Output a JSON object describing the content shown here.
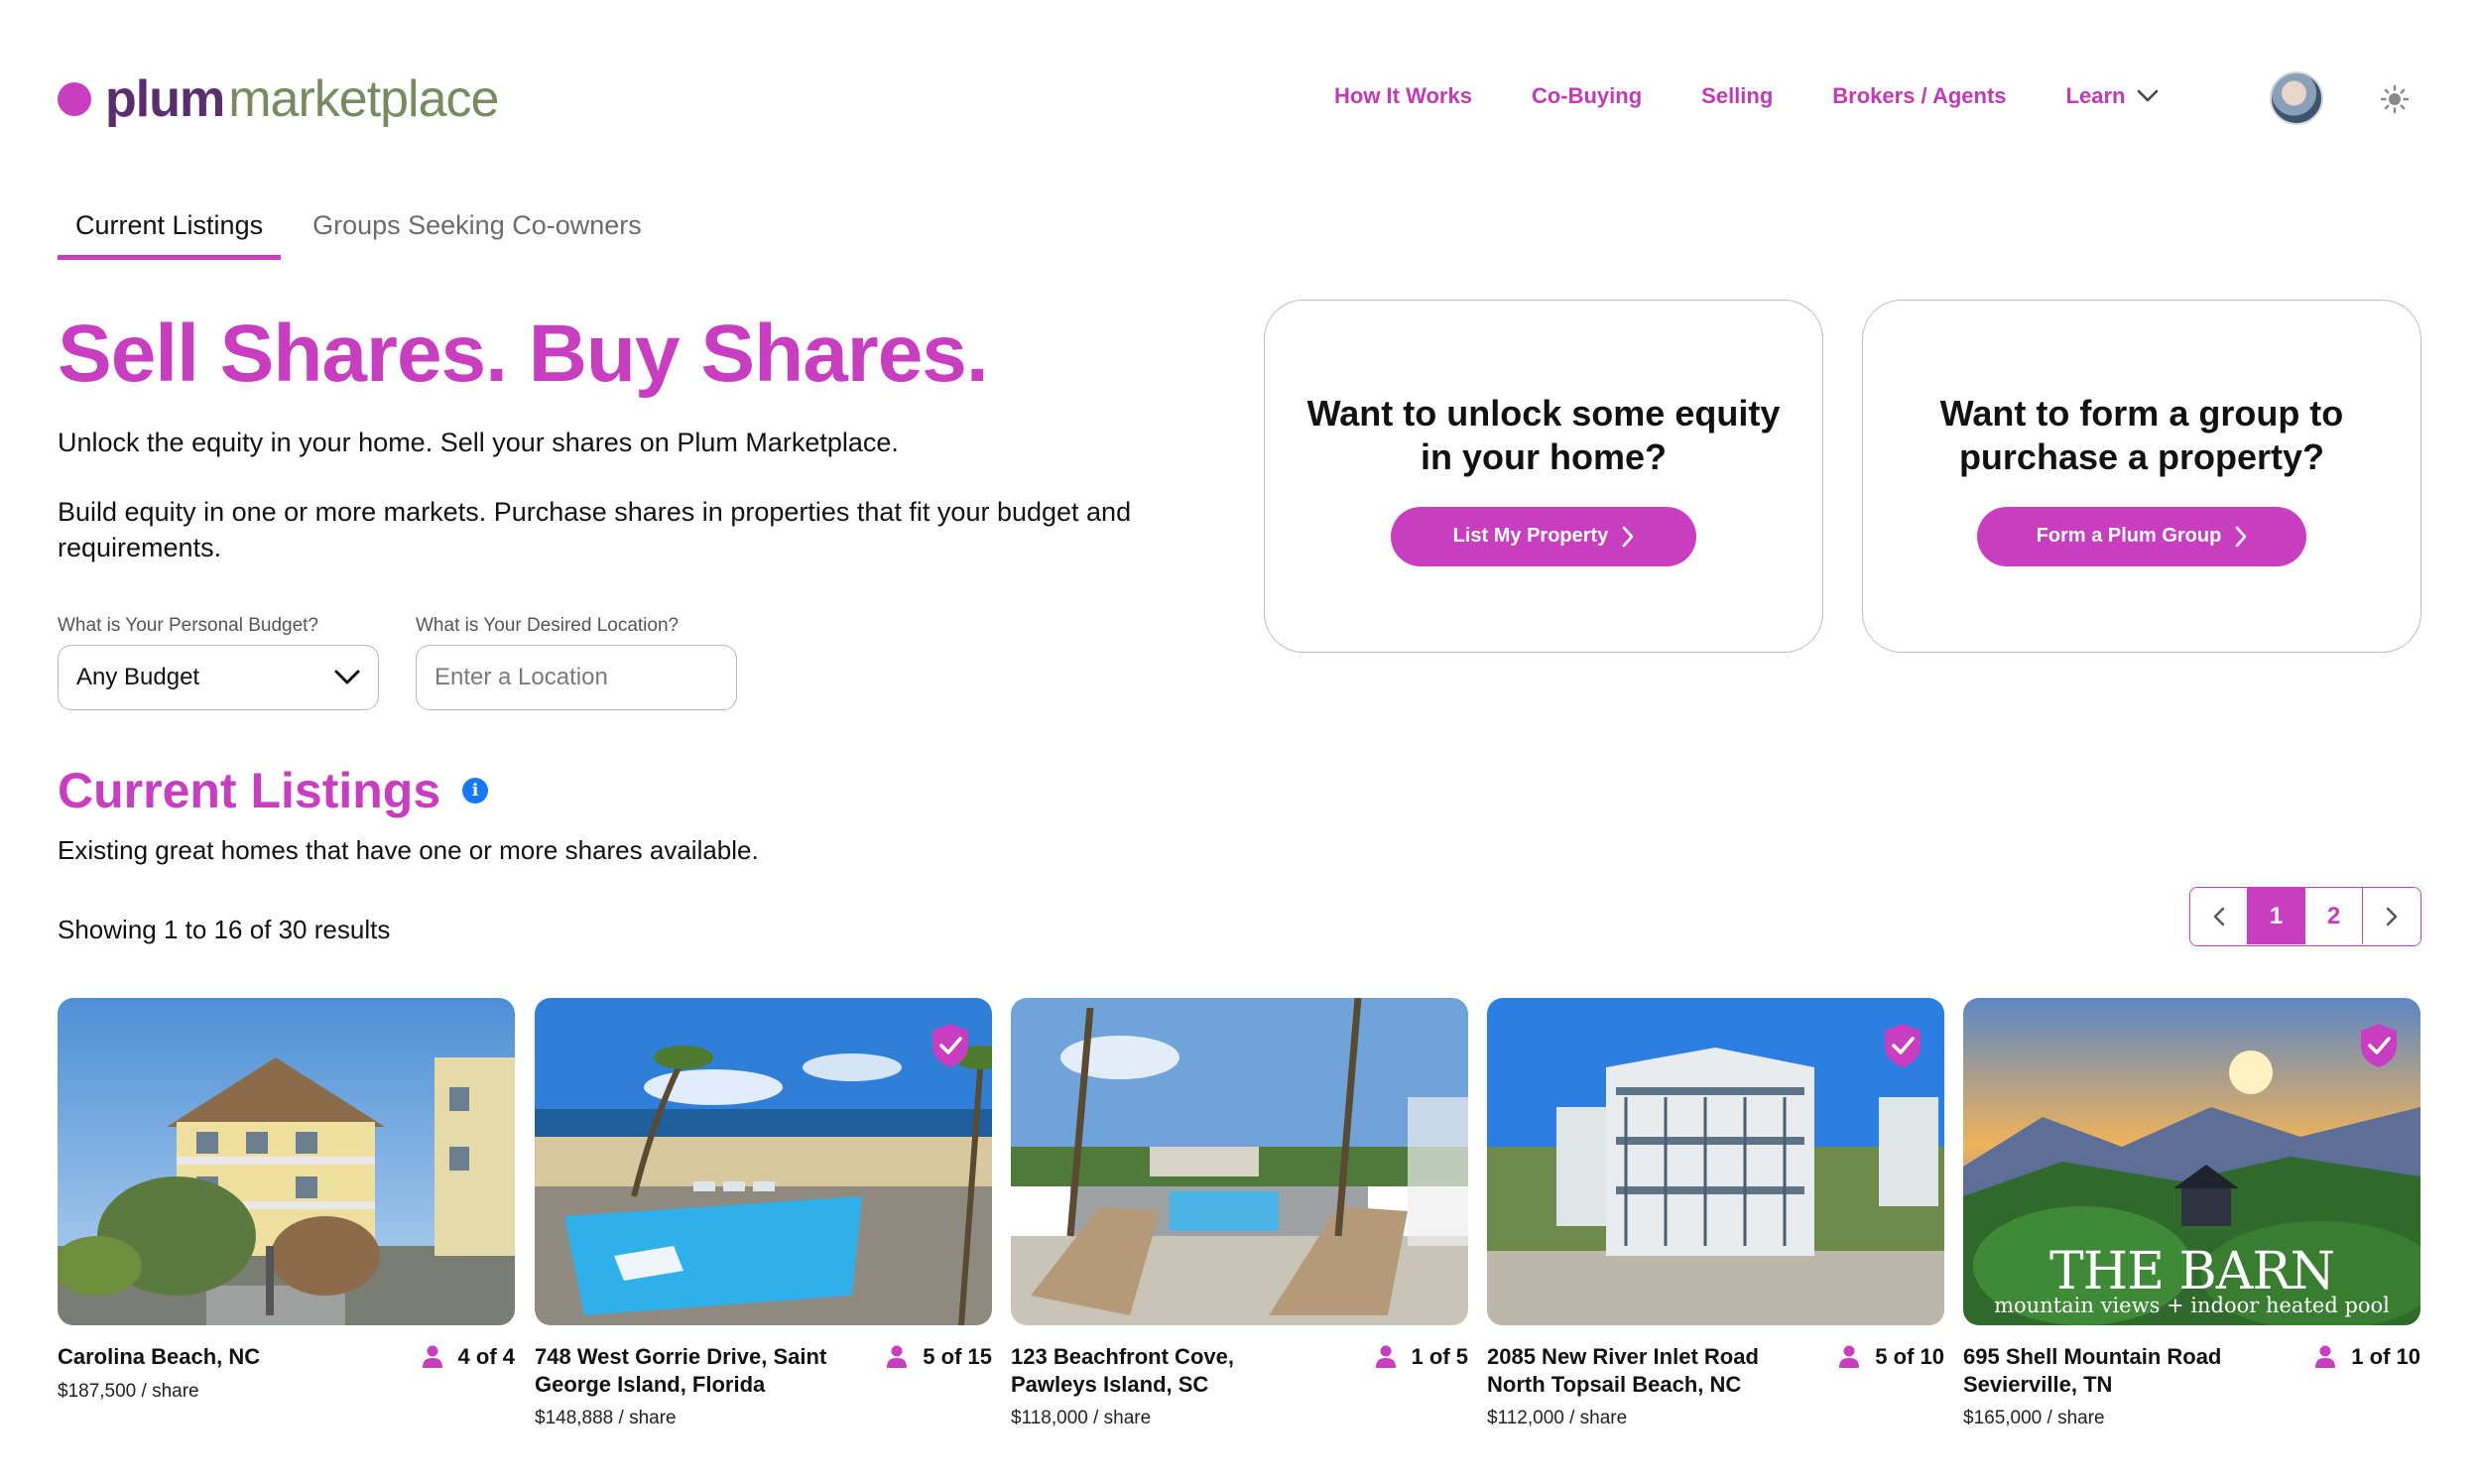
{
  "brand": {
    "name_part1": "plum",
    "name_part2": "marketplace",
    "accent": "#c93ec0"
  },
  "nav": {
    "items": [
      {
        "label": "How It Works"
      },
      {
        "label": "Co-Buying"
      },
      {
        "label": "Selling"
      },
      {
        "label": "Brokers / Agents"
      },
      {
        "label": "Learn",
        "icon": "chevron-down-icon"
      }
    ],
    "theme_icon": "sun-icon"
  },
  "tabs": [
    {
      "label": "Current Listings",
      "active": true
    },
    {
      "label": "Groups Seeking Co-owners",
      "active": false
    }
  ],
  "hero": {
    "title": "Sell Shares. Buy Shares.",
    "p1": "Unlock the equity in your home. Sell your shares on Plum Marketplace.",
    "p2": "Build equity in one or more markets. Purchase shares in properties that fit your budget and requirements."
  },
  "filters": {
    "budget_label": "What is Your Personal Budget?",
    "budget_value": "Any Budget",
    "location_label": "What is Your Desired Location?",
    "location_placeholder": "Enter a Location",
    "location_value": ""
  },
  "cta": [
    {
      "heading": "Want to unlock some equity in your home?",
      "button": "List My Property"
    },
    {
      "heading": "Want to form a group to purchase a property?",
      "button": "Form a Plum Group"
    }
  ],
  "listings": {
    "title": "Current Listings",
    "subtitle": "Existing great homes that have one or more shares available.",
    "results_text": "Showing 1 to 16 of 30 results",
    "pagination": {
      "pages": [
        "1",
        "2"
      ],
      "current": "1"
    },
    "cards": [
      {
        "address": "Carolina Beach, NC",
        "shares": "4 of 4",
        "price": "$187,500 / share",
        "verified": false
      },
      {
        "address": "748 West Gorrie Drive, Saint George Island, Florida",
        "shares": "5 of 15",
        "price": "$148,888 / share",
        "verified": true
      },
      {
        "address": "123 Beachfront Cove, Pawleys Island, SC",
        "shares": "1 of 5",
        "price": "$118,000 / share",
        "verified": false
      },
      {
        "address": "2085 New River Inlet Road North Topsail Beach, NC",
        "shares": "5 of 10",
        "price": "$112,000 / share",
        "verified": true
      },
      {
        "address": "695 Shell Mountain Road Sevierville, TN",
        "shares": "1 of 10",
        "price": "$165,000 / share",
        "verified": true,
        "image_text": {
          "title": "THE BARN",
          "tagline": "mountain views + indoor heated pool"
        }
      }
    ]
  }
}
